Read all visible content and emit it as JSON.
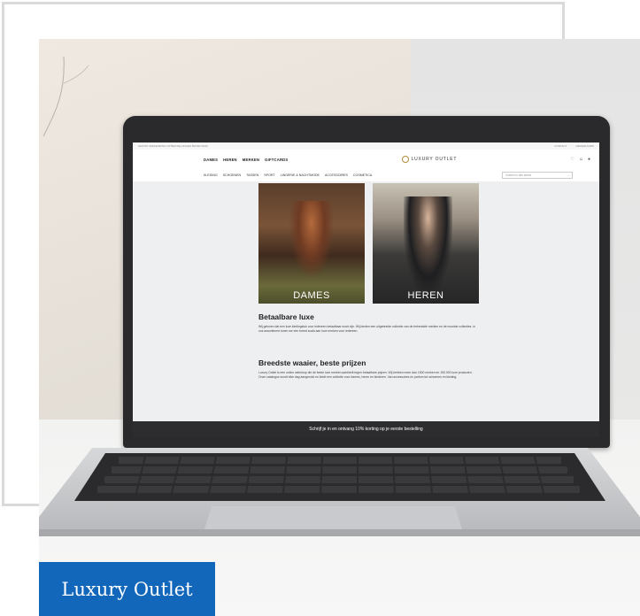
{
  "site": {
    "topbar_left": "GRATIS VERZENDING OP BESTELLINGEN BOVEN €100",
    "topbar_right": [
      "CONTACT",
      "NEDERLANDS"
    ],
    "main_nav": [
      "DAMES",
      "HEREN",
      "MERKEN",
      "GIFTCARDS"
    ],
    "logo": "LUXURY OUTLET",
    "sub_nav": [
      "KLEDING",
      "SCHOENEN",
      "TASSEN",
      "SPORT",
      "LINGERIE & NACHTMODE",
      "ACCESSOIRES",
      "COSMETICA"
    ],
    "search_placeholder": "Zoeken in alle labels",
    "tiles": [
      "DAMES",
      "HEREN"
    ],
    "section1_title": "Betaalbare luxe",
    "section1_text": "Wij geloven dat een luxe kledingstuk voor iedereen betaalbaar moet zijn. Wij bieden een uitgebreide collectie van de bekendste merken en de mooiste collecties. In ons assortiment tonen we een breed scala aan luxe merken voor iedereen.",
    "section2_title": "Breedste waaier, beste prijzen",
    "section2_text": "Luxury Outlet is een online webshop die de beste luxe merken aanbiedt tegen betaalbare prijzen. Wij hebben meer dan 1500 merken en 150.000 luxe producten. Onze catalogus wordt elke dag aangevuld en biedt een collectie voor dames, heren en kinderen. Van accessoires en parfum tot schoenen en kleding.",
    "newsletter": "Schrijf je in en ontvang 10% korting op je eerste bestelling"
  },
  "caption": "Luxury Outlet",
  "colors": {
    "caption_bg": "#1367bb",
    "frame": "#d9dadb"
  }
}
